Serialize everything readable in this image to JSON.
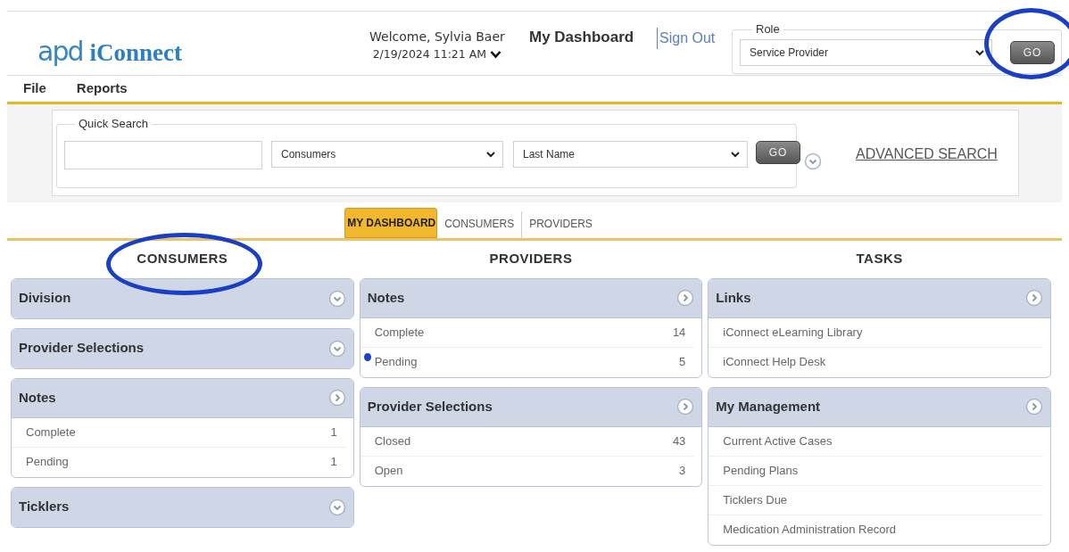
{
  "header": {
    "logo": {
      "mark": "apd",
      "name": "iConnect"
    },
    "welcome": "Welcome, Sylvia Baer",
    "datetime": "2/19/2024 11:21 AM",
    "page_title": "My Dashboard",
    "sign_out": "Sign Out",
    "role": {
      "legend": "Role",
      "value": "Service Provider",
      "go": "GO",
      "highlighted": true
    }
  },
  "menu": [
    "File",
    "Reports"
  ],
  "quick_search": {
    "legend": "Quick Search",
    "type": "Consumers",
    "field": "Last Name",
    "go": "GO",
    "advanced": "ADVANCED SEARCH"
  },
  "tabs": [
    {
      "label": "MY DASHBOARD",
      "selected": true
    },
    {
      "label": "CONSUMERS",
      "selected": false
    },
    {
      "label": "PROVIDERS",
      "selected": false
    }
  ],
  "columns": [
    {
      "heading": "CONSUMERS",
      "highlighted": true,
      "panels": [
        {
          "title": "Division",
          "expanded": false
        },
        {
          "title": "Provider Selections",
          "expanded": false
        },
        {
          "title": "Notes",
          "expanded": true,
          "items": [
            {
              "label": "Complete",
              "count": "1"
            },
            {
              "label": "Pending",
              "count": "1"
            }
          ]
        },
        {
          "title": "Ticklers",
          "expanded": false
        }
      ]
    },
    {
      "heading": "PROVIDERS",
      "panels": [
        {
          "title": "Notes",
          "expanded": true,
          "items": [
            {
              "label": "Complete",
              "count": "14"
            },
            {
              "label": "Pending",
              "count": "5",
              "flagged": true
            }
          ]
        },
        {
          "title": "Provider Selections",
          "expanded": true,
          "items": [
            {
              "label": "Closed",
              "count": "43"
            },
            {
              "label": "Open",
              "count": "3"
            }
          ]
        }
      ]
    },
    {
      "heading": "TASKS",
      "panels": [
        {
          "title": "Links",
          "expanded": true,
          "items": [
            {
              "label": "iConnect eLearning Library"
            },
            {
              "label": "iConnect Help Desk"
            }
          ]
        },
        {
          "title": "My Management",
          "expanded": true,
          "items": [
            {
              "label": "Current Active Cases"
            },
            {
              "label": "Pending Plans"
            },
            {
              "label": "Ticklers Due"
            },
            {
              "label": "Medication Administration Record"
            }
          ]
        }
      ]
    }
  ]
}
